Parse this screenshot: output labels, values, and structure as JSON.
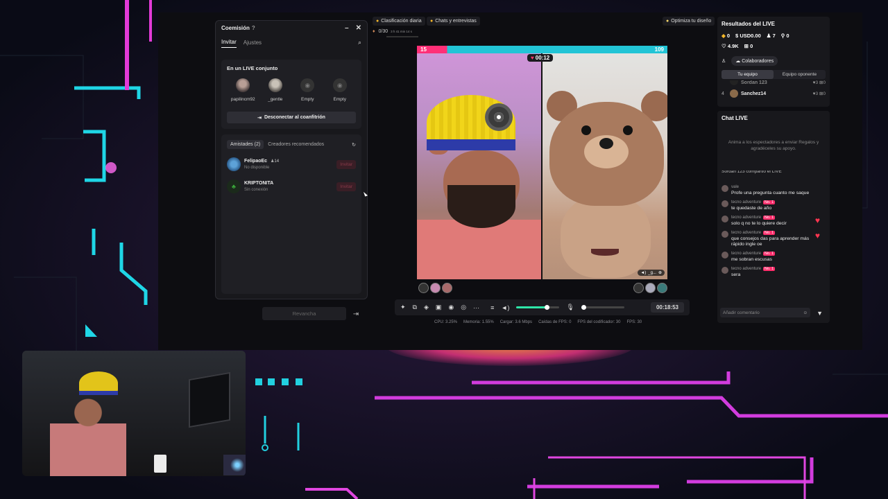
{
  "dialog": {
    "title": "Coemisión",
    "tabs": [
      "Invitar",
      "Ajustes"
    ],
    "section_title": "En un LIVE conjunto",
    "slots": [
      "papilincm92",
      "_gentle",
      "Empty",
      "Empty"
    ],
    "disconnect_label": "Desconectar al coanfitrión",
    "friends_tabs": [
      "Amistades (2)",
      "Creadores recomendados"
    ],
    "friends": [
      {
        "name": "FelipaoEc",
        "badge": "14",
        "status": "No disponible",
        "action": "Invitar"
      },
      {
        "name": "KRIPTONITA",
        "status": "Sin conexión",
        "action": "Invitar"
      }
    ],
    "rematch_label": "Revancha"
  },
  "top": {
    "pill_ranking": "Clasificación diaria",
    "pill_chats": "Chats y entrevistas",
    "progress": "0/30",
    "progress_time": "3 h 41 min 14 s",
    "optimize": "Optimiza tu diseño"
  },
  "battle": {
    "left_score": "15",
    "right_score": "109",
    "timer": "00:12",
    "tag": "_g..."
  },
  "controls": {
    "clock": "00:18:53",
    "volume_level": 0.7,
    "mic_level": 0.05
  },
  "stats": {
    "cpu": "CPU: 3.25%",
    "mem": "Memoria: 1.55%",
    "load": "Cargar: 3.6 Mbps",
    "drops": "Caídas de FPS: 0",
    "enc_fps": "FPS del codificador: 30",
    "fps": "FPS: 30"
  },
  "results": {
    "title": "Resultados del LIVE",
    "coins": "0",
    "usd": "USD0.00",
    "viewers": "7",
    "shares": "0",
    "likes": "4.9K",
    "gifts": "0",
    "collab_label": "Colaboradores",
    "team_tabs": [
      "Tu equipo",
      "Equipo oponente"
    ],
    "rank_partial": "Sordan 123",
    "rank_partial_likes": "3",
    "rank_partial_gifts": "0",
    "rank_num": "4",
    "rank_name": "Sanchez14",
    "rank_likes": "3",
    "rank_gifts": "0"
  },
  "chat": {
    "title": "Chat LIVE",
    "hint": "Anima a los espectadores a enviar Regalos y agradéceles su apoyo.",
    "partial": "Sordan 123 compartió el LIVE",
    "messages": [
      {
        "user": "vale",
        "badge": "",
        "text": "Profe una pregunta cuanto me saque"
      },
      {
        "user": "tecno adventure",
        "badge": "No. 1",
        "text": "te quedaste de año"
      },
      {
        "user": "tecno adventure",
        "badge": "No. 1",
        "text": "solo q no te lo quiere decir"
      },
      {
        "user": "tecno adventure",
        "badge": "No. 1",
        "text": "que consejos das para aprender más rápido ingle oe"
      },
      {
        "user": "tecno adventure",
        "badge": "No. 1",
        "text": "me sobran escusas"
      },
      {
        "user": "tecno adventure",
        "badge": "No. 1",
        "text": "sera"
      }
    ],
    "input_placeholder": "Añadir comentario"
  },
  "colors": {
    "accent": "#ff2f77",
    "teal": "#22c4d6",
    "green": "#2ee6a8"
  }
}
